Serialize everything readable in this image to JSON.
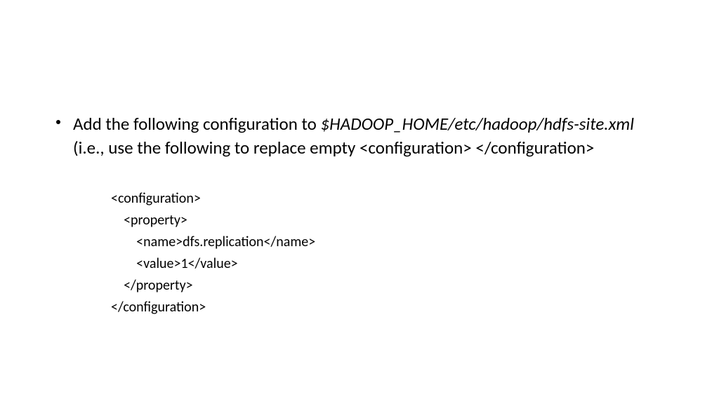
{
  "bullet": {
    "prefix": "Add the following configuration to ",
    "path": "$HADOOP_HOME/etc/hadoop/hdfs-site.xml",
    "suffix": "  (i.e., use the following to replace empty <configuration> </configuration>"
  },
  "code": {
    "l1": "<configuration>",
    "l2": "    <property>",
    "l3": "        <name>dfs.replication</name>",
    "l4": "        <value>1</value>",
    "l5": "    </property>",
    "l6": "</configuration>"
  }
}
